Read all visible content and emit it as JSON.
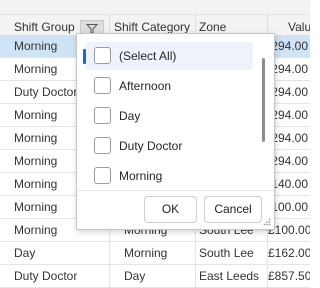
{
  "columns": [
    "Shift Group",
    "Shift Category",
    "Zone",
    "Valu"
  ],
  "rows": [
    [
      "Morning",
      "",
      "",
      "294.00"
    ],
    [
      "Morning",
      "",
      "",
      "294.00"
    ],
    [
      "Duty Doctor",
      "",
      "",
      "294.00"
    ],
    [
      "Morning",
      "",
      "",
      "294.00"
    ],
    [
      "Morning",
      "",
      "",
      "294.00"
    ],
    [
      "Morning",
      "",
      "",
      "294.00"
    ],
    [
      "Morning",
      "",
      "",
      "140.00"
    ],
    [
      "Morning",
      "",
      "",
      "100.00"
    ],
    [
      "Morning",
      "Morning",
      "South Lee",
      "£100.00"
    ],
    [
      "Day",
      "Morning",
      "South Lee",
      "£162.00"
    ],
    [
      "Duty Doctor",
      "Day",
      "East Leeds",
      "£857.50"
    ]
  ],
  "filter_popup": {
    "items": [
      {
        "label": "(Select All)",
        "checked": false
      },
      {
        "label": "Afternoon",
        "checked": false
      },
      {
        "label": "Day",
        "checked": false
      },
      {
        "label": "Duty Doctor",
        "checked": false
      },
      {
        "label": "Morning",
        "checked": false
      }
    ],
    "ok_label": "OK",
    "cancel_label": "Cancel"
  },
  "icons": {
    "filter": "filter-funnel-icon",
    "resize": "resize-grip-icon"
  },
  "colors": {
    "selected_row": "#cfe3f6",
    "accent": "#1f66c9"
  }
}
